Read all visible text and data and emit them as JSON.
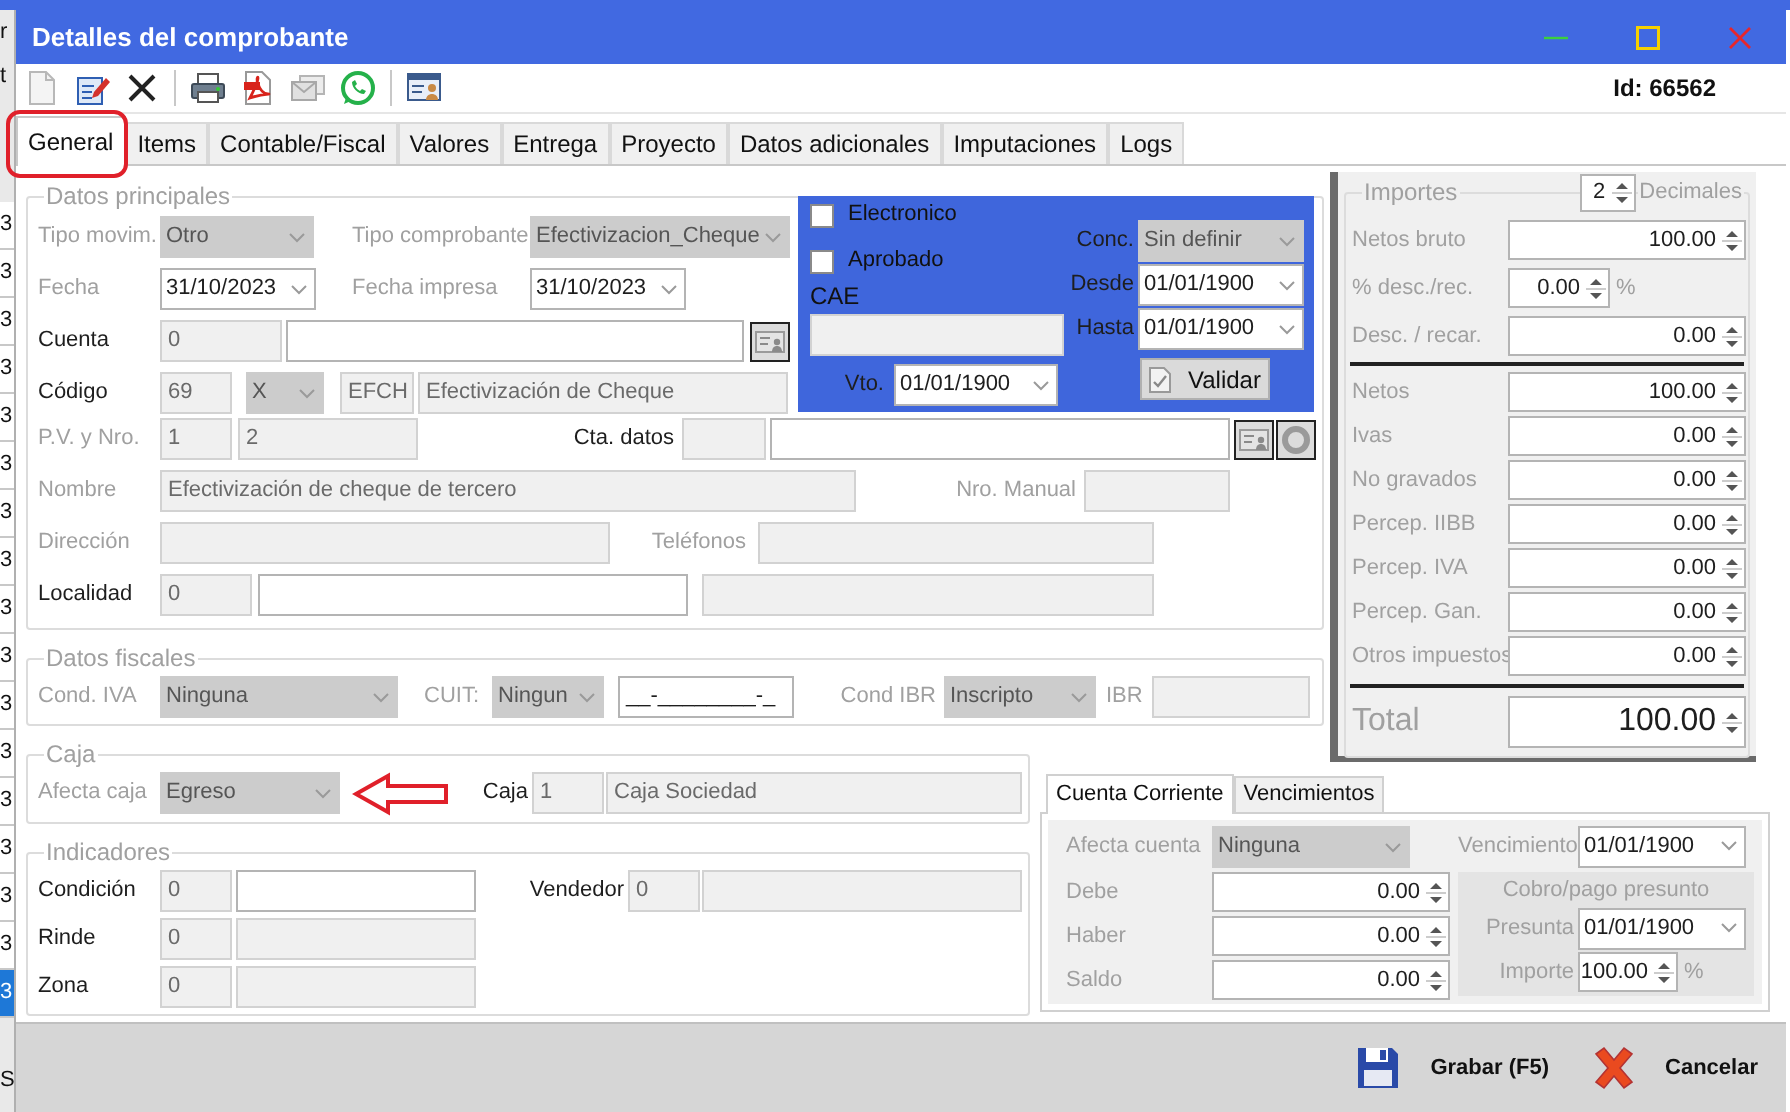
{
  "background_app": {
    "fragments": [
      "r",
      "t"
    ],
    "row_marks": [
      {
        "text": "3",
        "selected": false
      },
      {
        "text": "3",
        "selected": false
      },
      {
        "text": "3",
        "selected": false
      },
      {
        "text": "3",
        "selected": false
      },
      {
        "text": "3",
        "selected": false
      },
      {
        "text": "3",
        "selected": false
      },
      {
        "text": "3",
        "selected": false
      },
      {
        "text": "3",
        "selected": false
      },
      {
        "text": "3",
        "selected": false
      },
      {
        "text": "3",
        "selected": false
      },
      {
        "text": "3",
        "selected": false
      },
      {
        "text": "3",
        "selected": false
      },
      {
        "text": "3",
        "selected": false
      },
      {
        "text": "3",
        "selected": false
      },
      {
        "text": "3",
        "selected": false
      },
      {
        "text": "3",
        "selected": false
      },
      {
        "text": "3",
        "selected": true
      }
    ],
    "footer": "S"
  },
  "window": {
    "title": "Detalles del comprobante"
  },
  "toolbar": {
    "id_label": "Id: 66562"
  },
  "tabs": [
    {
      "label": "General",
      "selected": true
    },
    {
      "label": "Items",
      "selected": false
    },
    {
      "label": "Contable/Fiscal",
      "selected": false
    },
    {
      "label": "Valores",
      "selected": false
    },
    {
      "label": "Entrega",
      "selected": false
    },
    {
      "label": "Proyecto",
      "selected": false
    },
    {
      "label": "Datos adicionales",
      "selected": false
    },
    {
      "label": "Imputaciones",
      "selected": false
    },
    {
      "label": "Logs",
      "selected": false
    }
  ],
  "datos_principales": {
    "title": "Datos principales",
    "upper_rows": [
      [
        {
          "kind": "label",
          "text": "Tipo movim.",
          "disabled": true
        },
        {
          "kind": "select",
          "value": "Otro",
          "disabled": true
        },
        {
          "kind": "label",
          "text": "Tipo comprobante",
          "disabled": true
        },
        {
          "kind": "select",
          "value": "Efectivizacion_Cheque",
          "disabled": true
        }
      ],
      [
        {
          "kind": "label",
          "text": "Fecha",
          "disabled": true
        },
        {
          "kind": "date",
          "value": "31/10/2023"
        },
        {
          "kind": "label",
          "text": "Fecha impresa",
          "disabled": true
        },
        {
          "kind": "date",
          "value": "31/10/2023"
        }
      ],
      [
        {
          "kind": "label",
          "text": "Cuenta",
          "disabled": false
        },
        {
          "kind": "text",
          "value": "0",
          "disabled": true
        },
        {
          "kind": "text",
          "disabled": false
        },
        {
          "kind": "icon_button"
        }
      ],
      [
        {
          "kind": "label",
          "text": "Código",
          "disabled": false
        },
        {
          "kind": "text",
          "value": "69",
          "disabled": true
        },
        {
          "kind": "select",
          "value": "X",
          "disabled": true
        },
        {
          "kind": "text",
          "value": "EFCH",
          "disabled": true
        },
        {
          "kind": "text",
          "value": "Efectivización de Cheque",
          "disabled": true
        }
      ]
    ],
    "lower_rows": [
      [
        {
          "kind": "label",
          "text": "P.V. y Nro.",
          "disabled": true
        },
        {
          "kind": "text",
          "value": "1",
          "disabled": true
        },
        {
          "kind": "text",
          "value": "2",
          "disabled": true
        },
        {
          "kind": "label",
          "text": "Cta. datos",
          "disabled": false
        },
        {
          "kind": "text",
          "disabled": true
        },
        {
          "kind": "text",
          "disabled": false
        },
        {
          "kind": "icon_button"
        },
        {
          "kind": "icon_button"
        }
      ],
      [
        {
          "kind": "label",
          "text": "Nombre",
          "disabled": true
        },
        {
          "kind": "text",
          "value": "Efectivización de cheque de tercero",
          "disabled": true
        },
        {
          "kind": "label",
          "text": "Nro. Manual",
          "disabled": true
        },
        {
          "kind": "text",
          "disabled": true
        }
      ],
      [
        {
          "kind": "label",
          "text": "Dirección",
          "disabled": true
        },
        {
          "kind": "text",
          "disabled": true
        },
        {
          "kind": "label",
          "text": "Teléfonos",
          "disabled": true
        },
        {
          "kind": "text",
          "disabled": true
        }
      ],
      [
        {
          "kind": "label",
          "text": "Localidad",
          "disabled": false
        },
        {
          "kind": "text",
          "value": "0",
          "disabled": true
        },
        {
          "kind": "text",
          "disabled": false
        },
        {
          "kind": "text",
          "disabled": true
        }
      ]
    ]
  },
  "electronic_panel": {
    "checks": [
      {
        "label": "Electronico",
        "checked": false
      },
      {
        "label": "Aprobado",
        "checked": false
      }
    ],
    "cae_label": "CAE",
    "cae": {
      "kind": "text",
      "disabled": true
    },
    "vto": [
      {
        "kind": "label",
        "text": "Vto.",
        "disabled": false
      },
      {
        "kind": "date",
        "value": "01/01/1900"
      }
    ],
    "rows": [
      [
        {
          "kind": "label",
          "text": "Conc.",
          "disabled": false
        },
        {
          "kind": "select",
          "value": "Sin definir",
          "disabled": true
        }
      ],
      [
        {
          "kind": "label",
          "text": "Desde",
          "disabled": false
        },
        {
          "kind": "date",
          "value": "01/01/1900"
        }
      ],
      [
        {
          "kind": "label",
          "text": "Hasta",
          "disabled": false
        },
        {
          "kind": "date",
          "value": "01/01/1900"
        }
      ]
    ],
    "validate_button": "Validar"
  },
  "datos_fiscales": {
    "title": "Datos fiscales",
    "rows": [
      [
        {
          "kind": "label",
          "text": "Cond. IVA",
          "disabled": true
        },
        {
          "kind": "select",
          "value": "Ninguna",
          "disabled": true
        },
        {
          "kind": "label",
          "text": "CUIT:",
          "disabled": true
        },
        {
          "kind": "select",
          "value": "Ningun",
          "disabled": true
        },
        {
          "kind": "text",
          "value": "__-________-_",
          "disabled": false
        },
        {
          "kind": "label",
          "text": "Cond IBR",
          "disabled": true
        },
        {
          "kind": "select",
          "value": "Inscripto",
          "disabled": true
        },
        {
          "kind": "label",
          "text": "IBR",
          "disabled": true
        },
        {
          "kind": "text",
          "disabled": true
        }
      ]
    ]
  },
  "caja": {
    "title": "Caja",
    "rows": [
      [
        {
          "kind": "label",
          "text": "Afecta caja",
          "disabled": true
        },
        {
          "kind": "select",
          "value": "Egreso",
          "disabled": true
        },
        {
          "kind": "label",
          "text": "Caja",
          "disabled": false
        },
        {
          "kind": "text",
          "value": "1",
          "disabled": true
        },
        {
          "kind": "text",
          "value": "Caja Sociedad",
          "disabled": true
        }
      ]
    ]
  },
  "indicadores": {
    "title": "Indicadores",
    "rows": [
      [
        {
          "kind": "label",
          "text": "Condición",
          "disabled": false
        },
        {
          "kind": "text",
          "value": "0",
          "disabled": true
        },
        {
          "kind": "text",
          "disabled": false
        },
        {
          "kind": "label",
          "text": "Vendedor",
          "disabled": false
        },
        {
          "kind": "text",
          "value": "0",
          "disabled": true
        },
        {
          "kind": "text",
          "disabled": true
        }
      ],
      [
        {
          "kind": "label",
          "text": "Rinde",
          "disabled": false
        },
        {
          "kind": "text",
          "value": "0",
          "disabled": true
        },
        {
          "kind": "text",
          "disabled": true
        }
      ],
      [
        {
          "kind": "label",
          "text": "Zona",
          "disabled": false
        },
        {
          "kind": "text",
          "value": "0",
          "disabled": true
        },
        {
          "kind": "text",
          "disabled": true
        }
      ]
    ]
  },
  "importes": {
    "title": "Importes",
    "decimals": "2",
    "decimals_label": "Decimales",
    "sections": [
      [
        {
          "label": "Netos bruto",
          "value": "100.00"
        },
        {
          "label": "% desc./rec.",
          "value": "0.00",
          "suffix": "%"
        },
        {
          "label": "Desc. / recar.",
          "value": "0.00"
        }
      ],
      [
        {
          "label": "Netos",
          "value": "100.00"
        },
        {
          "label": "Ivas",
          "value": "0.00"
        },
        {
          "label": "No gravados",
          "value": "0.00"
        },
        {
          "label": "Percep. IIBB",
          "value": "0.00"
        },
        {
          "label": "Percep. IVA",
          "value": "0.00"
        },
        {
          "label": "Percep. Gan.",
          "value": "0.00"
        },
        {
          "label": "Otros impuestos",
          "value": "0.00"
        }
      ]
    ],
    "total": {
      "label": "Total",
      "value": "100.00"
    }
  },
  "cuenta_corriente": {
    "tabs": [
      {
        "label": "Cuenta Corriente",
        "selected": true
      },
      {
        "label": "Vencimientos",
        "selected": false
      }
    ],
    "afecta": [
      {
        "kind": "label",
        "text": "Afecta cuenta",
        "disabled": true
      },
      {
        "kind": "select",
        "value": "Ninguna",
        "disabled": true
      }
    ],
    "amounts": [
      {
        "label": "Debe",
        "value": "0.00"
      },
      {
        "label": "Haber",
        "value": "0.00"
      },
      {
        "label": "Saldo",
        "value": "0.00"
      }
    ],
    "vencimiento": {
      "label": "Vencimiento",
      "value": "01/01/1900"
    },
    "presunto": {
      "title": "Cobro/pago presunto",
      "date_label": "Presunta",
      "date": "01/01/1900",
      "amount_label": "Importe",
      "amount": "100.00",
      "suffix": "%"
    }
  },
  "actions": [
    {
      "label": "Grabar (F5)"
    },
    {
      "label": "Cancelar"
    }
  ]
}
